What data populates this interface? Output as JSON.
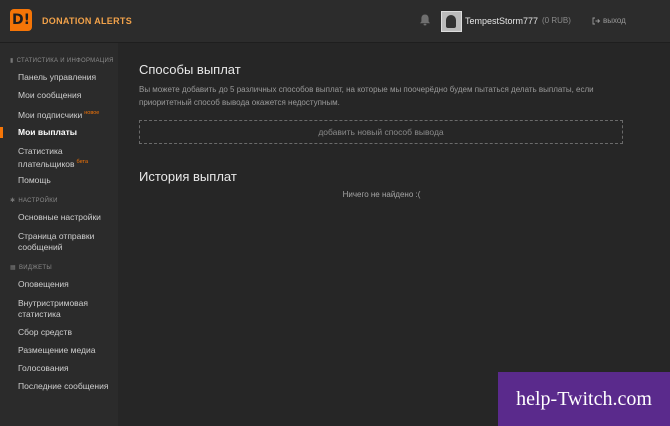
{
  "header": {
    "logo_glyph": "D!",
    "brand": "DONATION ALERTS",
    "username": "TempestStorm777",
    "balance": "(0 RUB)",
    "logout_icon": "logout-arrow-icon",
    "logout_label": "выход"
  },
  "sidebar": {
    "sections": [
      {
        "title": "СТАТИСТИКА И ИНФОРМАЦИЯ",
        "icon": "stats-icon",
        "items": [
          {
            "label": "Панель управления"
          },
          {
            "label": "Мои сообщения"
          },
          {
            "label": "Мои подписчики",
            "badge": "новое"
          },
          {
            "label": "Мои выплаты",
            "active": true
          },
          {
            "label_line1": "Статистика",
            "label_line2": "плательщиков",
            "badge": "бета"
          },
          {
            "label": "Помощь"
          }
        ]
      },
      {
        "title": "НАСТРОЙКИ",
        "icon": "gear-icon",
        "items": [
          {
            "label": "Основные настройки"
          },
          {
            "label_line1": "Страница отправки",
            "label_line2": "сообщений"
          }
        ]
      },
      {
        "title": "ВИДЖЕТЫ",
        "icon": "widgets-icon",
        "items": [
          {
            "label": "Оповещения"
          },
          {
            "label_line1": "Внутристримовая",
            "label_line2": "статистика"
          },
          {
            "label": "Сбор средств"
          },
          {
            "label": "Размещение медиа"
          },
          {
            "label": "Голосования"
          },
          {
            "label": "Последние сообщения"
          }
        ]
      }
    ]
  },
  "main": {
    "title": "Способы выплат",
    "description": "Вы можете добавить до 5 различных способов выплат, на которые мы поочерёдно будем пытаться делать выплаты, если приоритетный способ вывода окажется недоступным.",
    "add_method": "добавить новый способ вывода",
    "history_title": "История выплат",
    "empty_text": "Ничего не найдено :("
  },
  "watermark": "help-Twitch.com",
  "colors": {
    "accent": "#f57507",
    "background": "#262626",
    "sidebar": "#2b2b2b",
    "watermark_bg": "#5a2a8c"
  }
}
